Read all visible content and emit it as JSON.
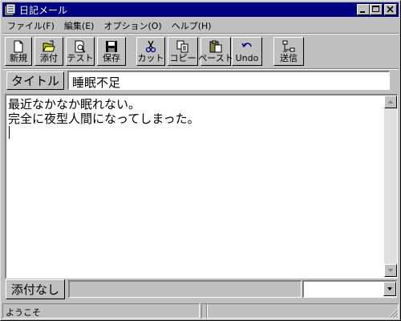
{
  "window": {
    "title": "日記メール",
    "accent": "#000080"
  },
  "menu": [
    {
      "label": "ファイル(F)"
    },
    {
      "label": "編集(E)"
    },
    {
      "label": "オプション(O)"
    },
    {
      "label": "ヘルプ(H)"
    }
  ],
  "toolbar": {
    "new_label": "新規",
    "attach_label": "添付",
    "test_label": "テスト",
    "save_label": "保存",
    "cut_label": "カット",
    "copy_label": "コピー",
    "paste_label": "ペースト",
    "undo_label": "Undo",
    "send_label": "送信"
  },
  "subject": {
    "label": "タイトル",
    "value": "睡眠不足"
  },
  "body": {
    "line1": "最近なかなか眠れない。",
    "line2": "完全に夜型人間になってしまった。"
  },
  "attachment": {
    "button_label": "添付なし",
    "path": "",
    "combo_value": ""
  },
  "status": {
    "message": "ようこそ",
    "pane2": "",
    "pane3": ""
  }
}
